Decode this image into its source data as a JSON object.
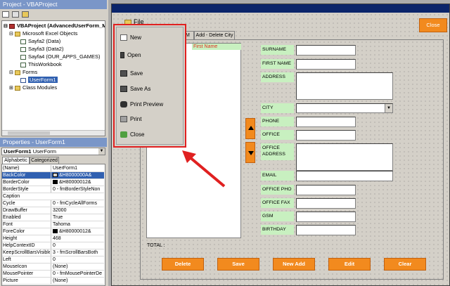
{
  "project": {
    "title": "Project - VBAProject",
    "root": "VBAProject (AdvancedUserForm_M",
    "nodes": [
      "Microsoft Excel Objects",
      "Sayfa2 (Data)",
      "Sayfa3 (Data2)",
      "Sayfa4 (OUR_APPS_GAMES)",
      "ThisWorkbook",
      "Forms",
      "UserForm1",
      "Class Modules"
    ]
  },
  "properties": {
    "title": "Properties - UserForm1",
    "object_name": "UserForm1",
    "object_type": "UserForm",
    "tab_alpha": "Alphabetic",
    "tab_cat": "Categorized",
    "rows": [
      {
        "name": "(Name)",
        "value": "UserForm1"
      },
      {
        "name": "BackColor",
        "value": "&H8000000A&"
      },
      {
        "name": "BorderColor",
        "value": "&H80000012&"
      },
      {
        "name": "BorderStyle",
        "value": "0 - fmBorderStyleNon"
      },
      {
        "name": "Caption",
        "value": ""
      },
      {
        "name": "Cycle",
        "value": "0 - fmCycleAllForms"
      },
      {
        "name": "DrawBuffer",
        "value": "32000"
      },
      {
        "name": "Enabled",
        "value": "True"
      },
      {
        "name": "Font",
        "value": "Tahoma"
      },
      {
        "name": "ForeColor",
        "value": "&H80000012&"
      },
      {
        "name": "Height",
        "value": "468"
      },
      {
        "name": "HelpContextID",
        "value": "0"
      },
      {
        "name": "KeepScrollBarsVisible",
        "value": "3 - fmScrollBarsBoth"
      },
      {
        "name": "Left",
        "value": "0"
      },
      {
        "name": "MouseIcon",
        "value": "(None)"
      },
      {
        "name": "MousePointer",
        "value": "0 - fmMousePointerDe"
      },
      {
        "name": "Picture",
        "value": "(None)"
      }
    ]
  },
  "form": {
    "file_menu": "File",
    "close_button": "Close",
    "tabs": [
      "RM",
      "Add - Delete City"
    ],
    "list_header": "First Name",
    "total_label": "TOTAL :",
    "fields": {
      "surname": "SURNAME",
      "first_name": "FIRST NAME",
      "address": "ADDRESS",
      "city": "CITY",
      "phone": "PHONE",
      "office": "OFFICE",
      "office_address": "OFFICE ADDRESS",
      "email": "EMAIL",
      "office_pho": "OFFICE PHO",
      "office_fax": "OFFICE FAX",
      "gsm": "GSM",
      "birthday": "BIRTHDAY"
    },
    "buttons": {
      "delete": "Delete",
      "save": "Save",
      "new_add": "New Add",
      "edit": "Edit",
      "clear": "Clear"
    },
    "menu": [
      "New",
      "Open",
      "Save",
      "Save As",
      "Print Preview",
      "Print",
      "Close"
    ]
  },
  "colors": {
    "accent_orange": "#f28a1e",
    "label_green": "#c8f0c0",
    "highlight_red": "#e02020"
  }
}
